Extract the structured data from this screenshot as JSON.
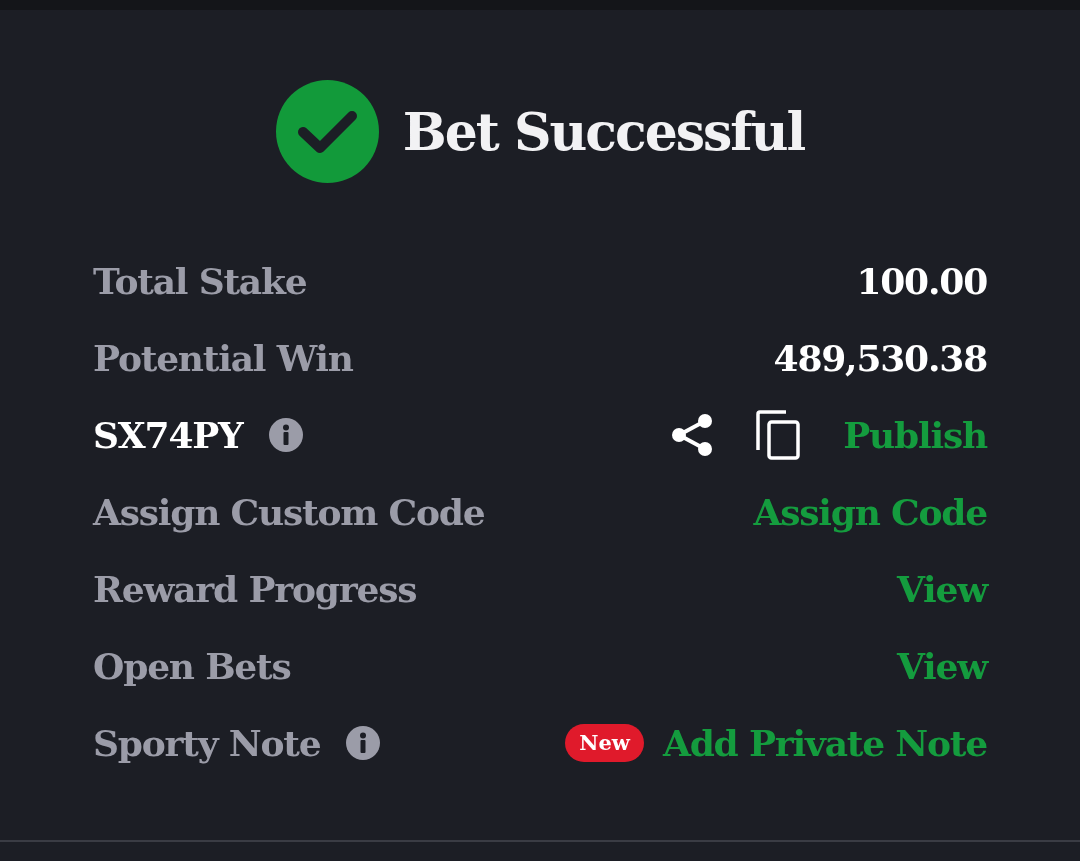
{
  "header": {
    "title": "Bet Successful"
  },
  "rows": [
    {
      "kind": "amount",
      "label": "Total Stake",
      "value": "100.00"
    },
    {
      "kind": "amount",
      "label": "Potential Win",
      "value": "489,530.38"
    },
    {
      "kind": "code",
      "label": "SX74PY",
      "info": true,
      "action": "Publish"
    },
    {
      "kind": "link",
      "label": "Assign Custom Code",
      "action": "Assign Code"
    },
    {
      "kind": "link",
      "label": "Reward Progress",
      "action": "View"
    },
    {
      "kind": "link",
      "label": "Open Bets",
      "action": "View"
    },
    {
      "kind": "link",
      "label": "Sporty Note",
      "info": true,
      "badge": "New",
      "action": "Add Private Note"
    }
  ]
}
